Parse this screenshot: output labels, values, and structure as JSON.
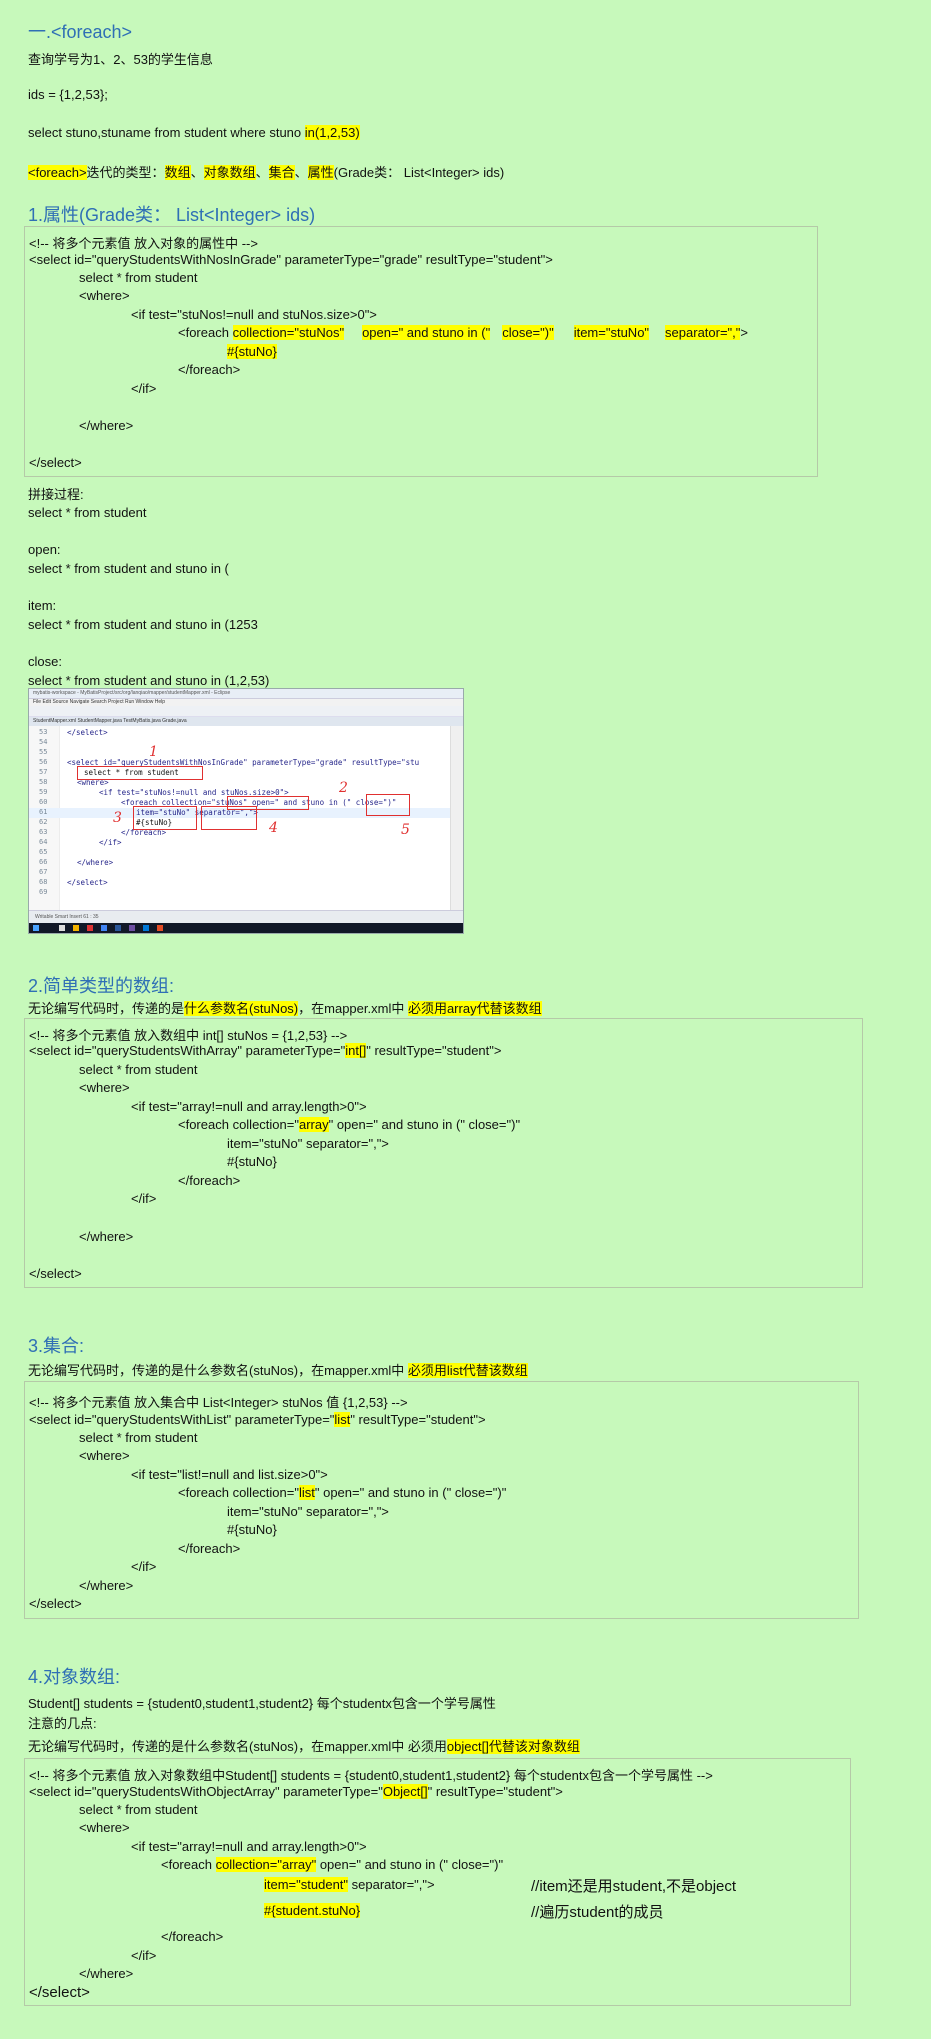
{
  "title": "一.<foreach>",
  "intro": {
    "query_line": "查询学号为1、2、53的学生信息",
    "ids_line": "ids = {1,2,53};",
    "sql_prefix": "select stuno,stuname from student  where stuno ",
    "sql_hl": "in(1,2,53)",
    "types_tag": "<foreach>",
    "types_text1": "迭代的类型：",
    "types_array": "数组",
    "sep1": "、",
    "types_objarray": "对象数组",
    "sep2": "、",
    "types_coll": "集合",
    "sep3": "、",
    "types_prop": "属性",
    "types_tail": "(Grade类：  List<Integer> ids)"
  },
  "s1": {
    "heading": "1.属性(Grade类：   List<Integer> ids)",
    "l1": "<!-- 将多个元素值 放入对象的属性中 -->",
    "l2": "<select id=\"queryStudentsWithNosInGrade\"  parameterType=\"grade\" resultType=\"student\">",
    "l3": "select * from student",
    "l4": "<where>",
    "l5": "<if test=\"stuNos!=null and stuNos.size>0\">",
    "l6a": "<foreach ",
    "l6b": "collection=\"stuNos\"",
    "l6c": "open=\" and  stuno in (\"",
    "l6d": "close=\")\"",
    "l6e": "item=\"stuNo\"",
    "l6f": "separator=\",\"",
    "l6g": ">",
    "l7": "#{stuNo}",
    "l8": "</foreach>",
    "l9": "</if>",
    "l10": "</where>",
    "l11": "</select>",
    "splice_title": "拼接过程:",
    "sp1": "select * from student",
    "sp2_label": "open:",
    "sp2": "select * from student and  stuno in (",
    "sp3_label": "item:",
    "sp3": "select * from student and  stuno in (1253",
    "sp4_label": "close:",
    "sp4": "select * from student and  stuno in (1,2,53)"
  },
  "shot": {
    "titlebar": "mybatis-workspace - MyBatisProject/src/org/lanqiao/mapper/studentMapper.xml - Eclipse",
    "menubar": "File  Edit  Source  Navigate  Search  Project  Run  Window  Help",
    "tabs": "StudentMapper.xml    StudentMapper.java    TestMyBatis.java    Grade.java",
    "status": "Writable      Smart Insert      61 : 35",
    "n53": "53",
    "c53": "</select>",
    "n54": "54",
    "n55": "55",
    "n56": "56",
    "c56": "<select id=\"queryStudentsWithNosInGrade\"  parameterType=\"grade\" resultType=\"stu",
    "n57": "57",
    "c57": "select * from student",
    "n58": "58",
    "c58": "<where>",
    "n59": "59",
    "c59": "<if test=\"stuNos!=null and stuNos.size>0\">",
    "n60": "60",
    "c60": "<foreach collection=\"stuNos\" open=\" and  stuno in (\" close=\")\"",
    "n61": "61",
    "c61": "item=\"stuNo\" separator=\",\">",
    "n62": "62",
    "c62": "#{stuNo}",
    "n63": "63",
    "c63": "</foreach>",
    "n64": "64",
    "c64": "</if>",
    "n65": "65",
    "n66": "66",
    "c66": "</where>",
    "n67": "67",
    "n68": "68",
    "c68": "</select>",
    "n69": "69",
    "mark1": "1",
    "mark2": "2",
    "mark3": "3",
    "mark4": "4",
    "mark5": "5"
  },
  "s2": {
    "heading": "2.简单类型的数组:",
    "desc1": "无论编写代码时，传递的是",
    "desc_hl1": "什么参数名(stuNos)",
    "desc2": "，在mapper.xml中 ",
    "desc_hl2": "必须用array代替该数组",
    "l1": "<!-- 将多个元素值 放入数组中 int[] stuNos = {1,2,53} -->",
    "l2a": "<select id=\"queryStudentsWithArray\"  parameterType=\"",
    "l2b": "int[]",
    "l2c": "\" resultType=\"student\">",
    "l3": "select * from student",
    "l4": "<where>",
    "l5": "<if test=\"array!=null and array.length>0\">",
    "l6a": "<foreach collection=\"",
    "l6b": "array",
    "l6c": "\" open=\" and  stuno in (\" close=\")\"",
    "l7": "item=\"stuNo\" separator=\",\">",
    "l8": "#{stuNo}",
    "l9": "</foreach>",
    "l10": "</if>",
    "l11": "</where>",
    "l12": "</select>"
  },
  "s3": {
    "heading": "3.集合:",
    "desc1": "无论编写代码时，传递的是什么参数名(stuNos)，在mapper.xml中 ",
    "desc_hl": "必须用list代替该数组",
    "l1": "<!-- 将多个元素值 放入集合中 List<Integer> stuNos 值 {1,2,53} -->",
    "l2a": "<select id=\"queryStudentsWithList\"  parameterType=\"",
    "l2b": "list",
    "l2c": "\" resultType=\"student\">",
    "l3": "select * from student",
    "l4": "<where>",
    "l5": "<if test=\"list!=null and list.size>0\">",
    "l6a": "<foreach collection=\"",
    "l6b": "list",
    "l6c": "\" open=\" and  stuno in (\" close=\")\"",
    "l7": "item=\"stuNo\" separator=\",\">",
    "l8": "#{stuNo}",
    "l9": "</foreach>",
    "l10": "</if>",
    "l11": "</where>",
    "l12": "</select>"
  },
  "s4": {
    "heading": "4.对象数组:",
    "p1": "Student[] students = {student0,student1,student2}  每个studentx包含一个学号属性",
    "p2": "注意的几点:",
    "p3a": "无论编写代码时，传递的是什么参数名(stuNos)，在mapper.xml中 必须用",
    "p3b": "object[]代替该对象数组",
    "l1": "<!-- 将多个元素值 放入对象数组中Student[] students = {student0,student1,student2}  每个studentx包含一个学号属性 -->",
    "l2a": "<select id=\"queryStudentsWithObjectArray\"  parameterType=\"",
    "l2b": "Object[]",
    "l2c": "\" resultType=\"student\">",
    "l3": "select * from student",
    "l4": "<where>",
    "l5": "<if test=\"array!=null and array.length>0\">",
    "l6a": "<foreach ",
    "l6b": "collection=\"array\"",
    "l6c": " open=\" and  stuno in (\" close=\")\"",
    "l7a": "item=\"student\"",
    "l7b": " separator=\",\">",
    "l7note": "//item还是用student,不是object",
    "l8a": "#{student.stuNo}",
    "l8note": "//遍历student的成员",
    "l9": "</foreach>",
    "l10": "</if>",
    "l11": "</where>",
    "l12": "</select>"
  }
}
